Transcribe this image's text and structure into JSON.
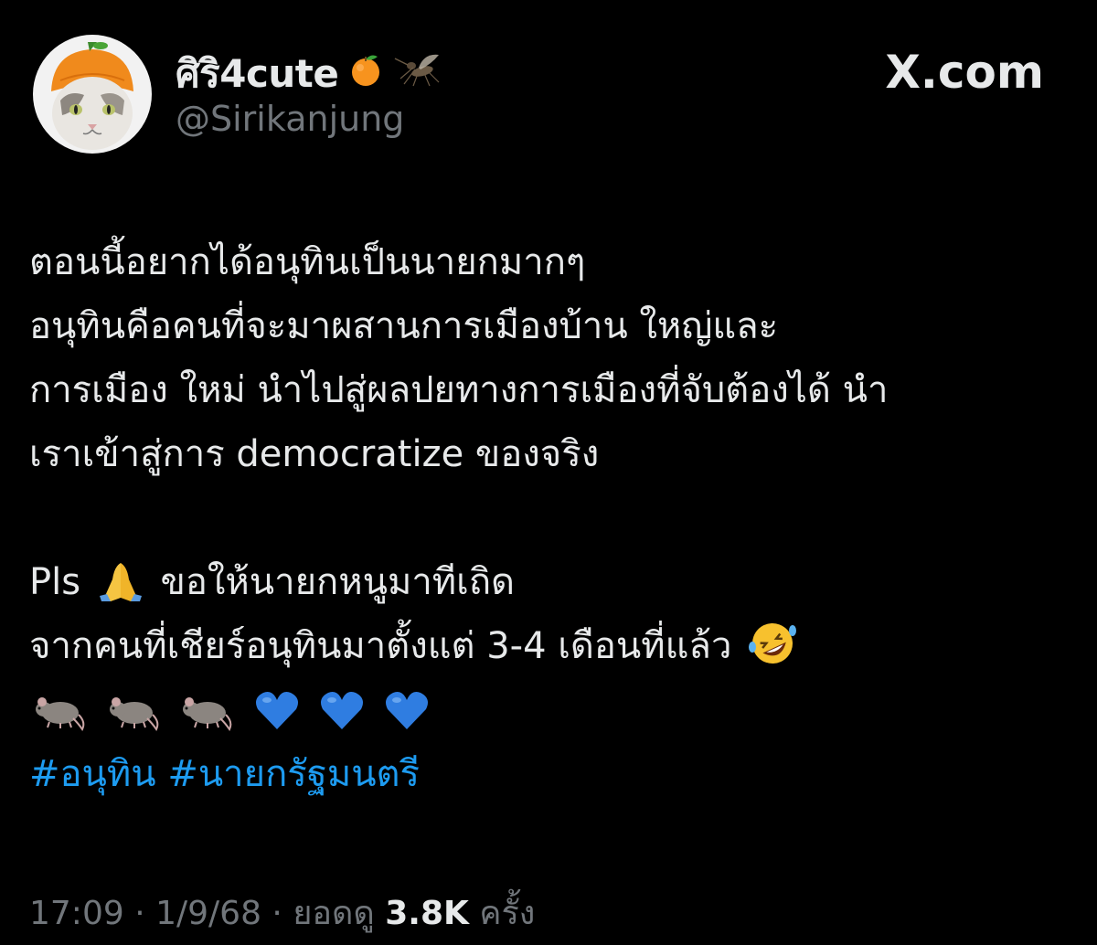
{
  "brand": "X.com",
  "author": {
    "display_name": "ศิริ4cute",
    "handle": "@Sirikanjung",
    "name_emojis": [
      "orange-emoji",
      "mosquito-emoji"
    ]
  },
  "tweet": {
    "lines": [
      "ตอนนี้อยากได้อนุทินเป็นนายกมากๆ",
      "อนุทินคือคนที่จะมาผสานการเมืองบ้าน ใหญ่และ",
      "การเมือง ใหม่ นำไปสู่ผลปยทางการเมืองที่จับต้องได้ นำ",
      "เราเข้าสู่การ democratize ของจริง"
    ],
    "line_pls_prefix": "Pls",
    "line_pls_rest": "ขอให้นายกหนูมาทีเถิด",
    "line_cheer": "จากคนที่เชียร์อนุทินมาตั้งแต่ 3-4 เดือนที่แล้ว",
    "emoji_row": [
      "rat-emoji",
      "rat-emoji",
      "rat-emoji",
      "blue-heart-emoji",
      "blue-heart-emoji",
      "blue-heart-emoji"
    ],
    "hashtags": [
      "#อนุทิน",
      "#นายกรัฐมนตรี"
    ]
  },
  "meta": {
    "time": "17:09",
    "sep1": " · ",
    "date": "1/9/68",
    "sep2": " · ",
    "views_label": "ยอดดู",
    "views_count": "3.8K",
    "views_suffix": "ครั้ง"
  },
  "colors": {
    "background": "#000000",
    "text": "#e7e9ea",
    "muted": "#71767b",
    "link": "#1d9bf0"
  }
}
